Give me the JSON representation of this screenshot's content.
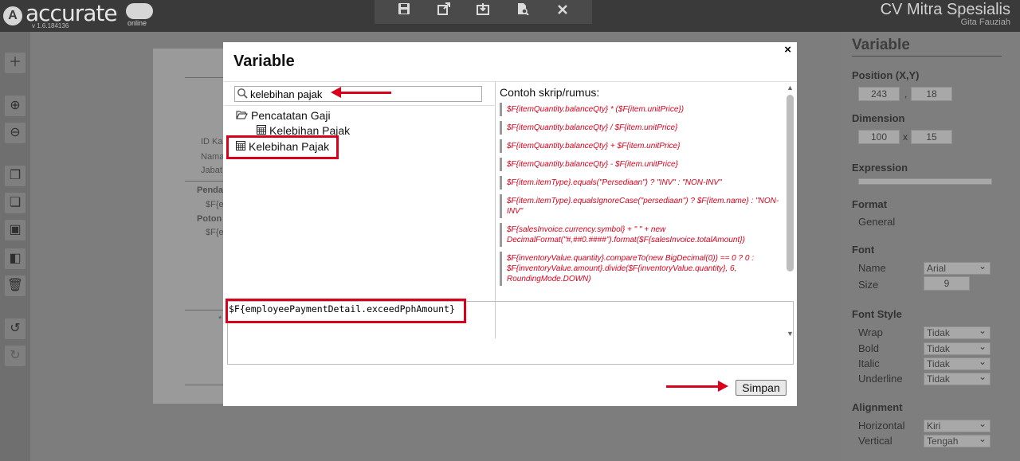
{
  "brand": {
    "logo_text": "accurate",
    "version": "v 1.6.184136",
    "sub": "online",
    "badge": "A"
  },
  "company": {
    "name": "CV Mitra Spesialis",
    "user": "Gita Fauziah"
  },
  "toolbar": {
    "icons": [
      "save-icon",
      "export-icon",
      "import-icon",
      "preview-icon",
      "close-icon"
    ]
  },
  "paper": {
    "labels": [
      "ID Ka",
      "Nama",
      "Jabat",
      "Penda",
      "$F{e",
      "Poton",
      "$F{e",
      "*"
    ]
  },
  "modal": {
    "title": "Variable",
    "close": "×",
    "search_value": "kelebihan pajak",
    "tree": {
      "folder": "Pencatatan Gaji",
      "child": "Kelebihan Pajak",
      "root_item": "Kelebihan Pajak"
    },
    "examples_title": "Contoh skrip/rumus:",
    "examples": [
      "$F{itemQuantity.balanceQty} * ($F{item.unitPrice})",
      "$F{itemQuantity.balanceQty} / $F{item.unitPrice}",
      "$F{itemQuantity.balanceQty} + $F{item.unitPrice}",
      "$F{itemQuantity.balanceQty} - $F{item.unitPrice}",
      "$F{item.itemType}.equals(\"Persediaan\") ? \"INV\" : \"NON-INV\"",
      "$F{item.itemType}.equalsIgnoreCase(\"persediaan\") ? $F{item.name} : \"NON-INV\"",
      "$F{salesInvoice.currency.symbol} + \" \" + new DecimalFormat(\"#,##0.####\").format($F{salesInvoice.totalAmount})",
      "$F{inventoryValue.quantity}.compareTo(new BigDecimal(0)) == 0 ? 0 : $F{inventoryValue.amount}.divide($F{inventoryValue.quantity}, 6, RoundingMode.DOWN)"
    ],
    "expression": "$F{employeePaymentDetail.exceedPphAmount}",
    "save_label": "Simpan"
  },
  "props": {
    "title": "Variable",
    "position_label": "Position (X,Y)",
    "pos_x": "243",
    "pos_y": "18",
    "dimension_label": "Dimension",
    "dim_w": "100",
    "dim_h": "15",
    "dim_sep": "x",
    "pos_sep": ",",
    "expression_label": "Expression",
    "format_label": "Format",
    "format_value": "General",
    "font_label": "Font",
    "font_name_label": "Name",
    "font_name": "Arial",
    "font_size_label": "Size",
    "font_size": "9",
    "font_style_label": "Font Style",
    "wrap_label": "Wrap",
    "wrap": "Tidak",
    "bold_label": "Bold",
    "bold": "Tidak",
    "italic_label": "Italic",
    "italic": "Tidak",
    "underline_label": "Underline",
    "underline": "Tidak",
    "alignment_label": "Alignment",
    "horizontal_label": "Horizontal",
    "horizontal": "Kiri",
    "vertical_label": "Vertical",
    "vertical": "Tengah"
  },
  "colors": {
    "accent_red": "#d9001b",
    "overlay": "#7d7d7d"
  }
}
